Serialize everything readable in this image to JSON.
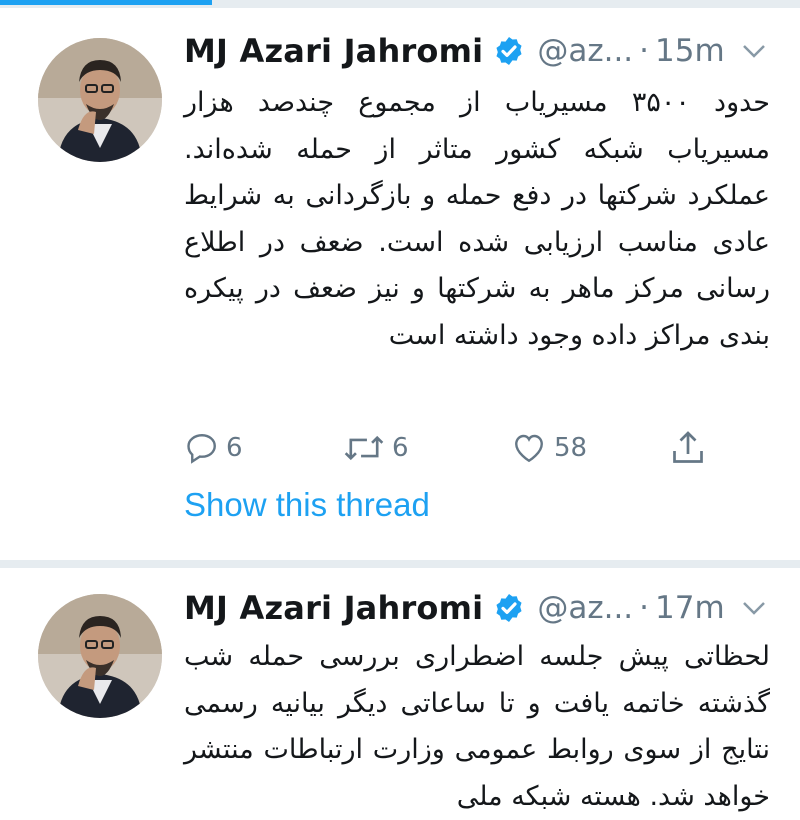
{
  "colors": {
    "accent": "#1da1f2",
    "text": "#14171a",
    "muted": "#657786",
    "separator": "#e6ecf0"
  },
  "tweets": [
    {
      "author_name": "MJ Azari Jahromi",
      "handle": "@az...",
      "dot": "·",
      "time": "15m",
      "verified_icon": "verified-badge-icon",
      "text": "حدود ۳۵۰۰ مسیریاب از مجموع چندصد هزار مسیریاب شبکه کشور متاثر از حمله شده‌اند. عملکرد شرکتها در دفع حمله و بازگردانی به شرایط عادی مناسب ارزیابی شده است. ضعف در اطلاع رسانی مرکز ماهر به شرکتها و نیز ضعف در پیکره بندی مراکز داده وجود داشته است",
      "actions": {
        "reply_count": "6",
        "retweet_count": "6",
        "like_count": "58"
      },
      "show_thread": "Show this thread"
    },
    {
      "author_name": "MJ Azari Jahromi",
      "handle": "@az...",
      "dot": "·",
      "time": "17m",
      "verified_icon": "verified-badge-icon",
      "text": "لحظاتی پیش جلسه اضطراری بررسی حمله شب گذشته خاتمه یافت و تا ساعاتی دیگر بیانیه رسمی نتایج از سوی روابط عمومی وزارت ارتباطات منتشر خواهد شد. هسته شبکه ملی"
    }
  ]
}
